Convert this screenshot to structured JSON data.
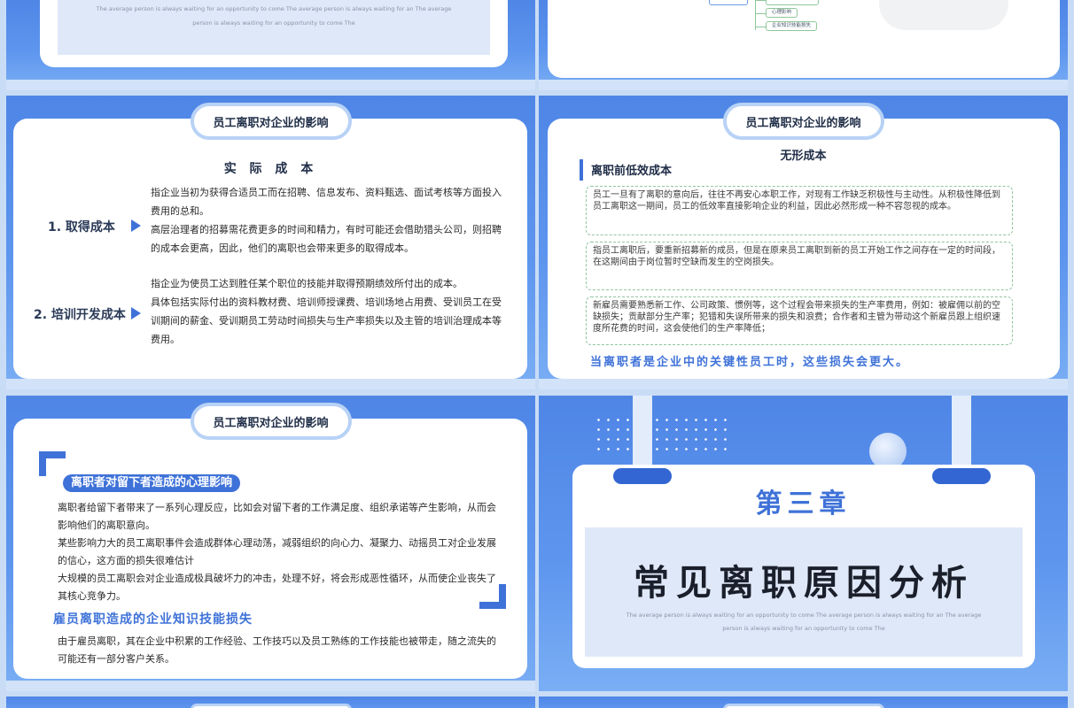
{
  "slide1": {
    "en_line1": "The average person is always waiting for an opportunity to come The average person is always waiting for an The average",
    "en_line2": "person is always waiting for an opportunity to come The"
  },
  "slide2": {
    "nodes": [
      "心理影响",
      "企业知识技能损失"
    ]
  },
  "slide3": {
    "pill": "员工离职对企业的影响",
    "title": "实 际 成 本",
    "row1_label": "1. 取得成本",
    "row1_p1": "指企业当初为获得合适员工而在招聘、信息发布、资料甄选、面试考核等方面投入费用的总和。",
    "row1_p2": "高层治理者的招募需花费更多的时间和精力，有时可能还会借助猎头公司，则招聘的成本会更高，因此，他们的离职也会带来更多的取得成本。",
    "row2_label": "2. 培训开发成本",
    "row2_p1": "指企业为使员工达到胜任某个职位的技能并取得预期绩效所付出的成本。",
    "row2_p2": "具体包括实际付出的资料教材费、培训师授课费、培训场地占用费、受训员工在受训期间的薪金、受训期员工劳动时间损失与生产率损失以及主管的培训治理成本等费用。"
  },
  "slide4": {
    "pill": "员工离职对企业的影响",
    "head": "无形成本",
    "sub": "离职前低效成本",
    "box1": "员工一旦有了离职的意向后，往往不再安心本职工作，对现有工作缺乏积极性与主动性。从积极性降低到员工离职这一期间，员工的低效率直接影响企业的利益，因此必然形成一种不容忽视的成本。",
    "box2": "指员工离职后，要重新招募新的成员，但是在原来员工离职到新的员工开始工作之间存在一定的时间段，在这期间由于岗位暂时空缺而发生的空岗损失。",
    "box3": "新雇员需要熟悉新工作、公司政策、惯例等，这个过程会带来损失的生产率费用，例如：被雇佣以前的空缺损失；贡献部分生产率；犯错和失误所带来的损失和浪费；合作者和主管为带动这个新雇员跟上组织速度所花费的时间，这会使他们的生产率降低；",
    "bottom": "当离职者是企业中的关键性员工时，这些损失会更大。"
  },
  "slide5": {
    "pill": "员工离职对企业的影响",
    "highlight": "离职者对留下者造成的心理影响",
    "p1": "离职者给留下者带来了一系列心理反应，比如会对留下者的工作满足度、组织承诺等产生影响，从而会影响他们的离职意向。",
    "p2": "某些影响力大的员工离职事件会造成群体心理动荡，减弱组织的向心力、凝聚力、动摇员工对企业发展的信心，这方面的损失很难估计",
    "p3": "大规模的员工离职会对企业造成极具破坏力的冲击，处理不好，将会形成恶性循环，从而使企业丧失了其核心竞争力。",
    "sub": "雇员离职造成的企业知识技能损失",
    "p4": "由于雇员离职，其在企业中积累的工作经验、工作技巧以及员工熟练的工作技能也被带走，随之流失的可能还有一部分客户关系。"
  },
  "slide6": {
    "chapter": "第三章",
    "title": "常见离职原因分析",
    "en_line1": "The average person is always waiting for an opportunity to come The average person is always waiting for an The average",
    "en_line2": "person is always waiting for an opportunity to come The"
  },
  "colors": {
    "accent": "#3f72d8",
    "slide_bg_top": "#4f86e6",
    "slide_bg_bottom": "#7aaef4",
    "pill_border": "#b8d2f6",
    "panel": "#dfe8f8",
    "dashed_border": "#8fc4a0"
  },
  "icons": {
    "row_marker": "triangle-right-icon",
    "corner_brackets": "bracket-corner-icon"
  }
}
